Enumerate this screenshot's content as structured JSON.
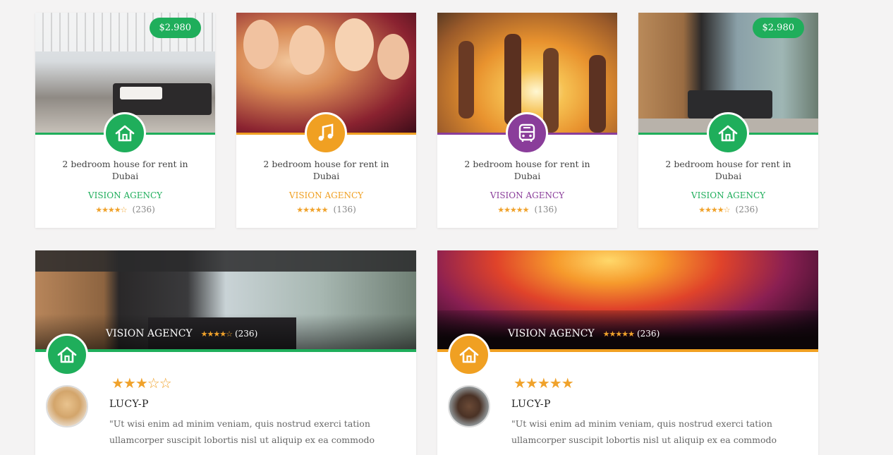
{
  "colors": {
    "green": "#1fae5b",
    "orange": "#f0a022",
    "purple": "#8a3d9a",
    "star": "#f0a22b"
  },
  "small_cards": [
    {
      "title": "2 bedroom house for rent in Dubai",
      "agency": "VISION AGENCY",
      "stars": "★★★★☆",
      "count": "(236)",
      "price": "$2.980",
      "icon": "home-icon",
      "accent": "green"
    },
    {
      "title": "2 bedroom house for rent in Dubai",
      "agency": "VISION AGENCY",
      "stars": "★★★★★",
      "count": "(136)",
      "price": "",
      "icon": "music-note-icon",
      "accent": "orange"
    },
    {
      "title": "2 bedroom house for rent in Dubai",
      "agency": "VISION AGENCY",
      "stars": "★★★★★",
      "count": "(136)",
      "price": "",
      "icon": "bus-icon",
      "accent": "purple"
    },
    {
      "title": "2 bedroom house for rent in Dubai",
      "agency": "VISION AGENCY",
      "stars": "★★★★☆",
      "count": "(236)",
      "price": "$2.980",
      "icon": "home-icon",
      "accent": "green"
    }
  ],
  "big_cards": [
    {
      "agency": "VISION AGENCY",
      "stars": "★★★★☆",
      "count": "(236)",
      "review_stars": "★★★☆☆",
      "reviewer": "LUCY-P",
      "review": "\"Ut wisi enim ad minim veniam, quis nostrud exerci tation ullamcorper suscipit lobortis nisl ut aliquip ex ea commodo",
      "icon": "home-icon",
      "accent": "green"
    },
    {
      "agency": "VISION AGENCY",
      "stars": "★★★★★",
      "count": "(236)",
      "review_stars": "★★★★★",
      "reviewer": "LUCY-P",
      "review": "\"Ut wisi enim ad minim veniam, quis nostrud exerci tation ullamcorper suscipit lobortis nisl ut aliquip ex ea commodo",
      "icon": "home-icon",
      "accent": "orange"
    }
  ]
}
